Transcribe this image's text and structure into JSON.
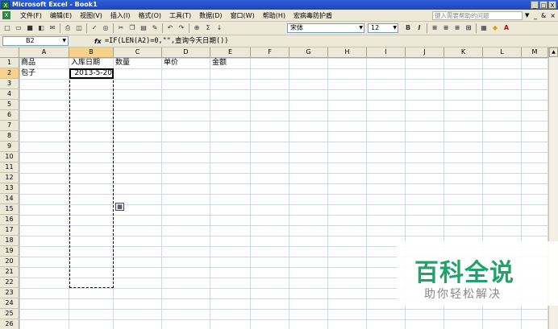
{
  "window": {
    "title": "Microsoft Excel - Book1",
    "controls": [
      "_",
      "□",
      "X"
    ]
  },
  "menu": {
    "items": [
      "文件(F)",
      "编辑(E)",
      "视图(V)",
      "插入(I)",
      "格式(O)",
      "工具(T)",
      "数据(D)",
      "窗口(W)",
      "帮助(H)",
      "宏病毒防护盾"
    ],
    "help_placeholder": "键入需要帮助的问题",
    "doc_controls": [
      "-",
      "_",
      "&",
      "×"
    ]
  },
  "toolbar": {
    "font_name": "宋体",
    "font_size": "12",
    "bold": "B",
    "italic": "I"
  },
  "formula_bar": {
    "name_box": "B2",
    "fx": "fx",
    "formula": "=IF(LEN(A2)=0,\"\",查询今天日期())"
  },
  "grid": {
    "columns": [
      "A",
      "B",
      "C",
      "D",
      "E",
      "F",
      "G",
      "H",
      "I",
      "J",
      "K",
      "L",
      "M"
    ],
    "rows": [
      "1",
      "2",
      "3",
      "4",
      "5",
      "6",
      "7",
      "8",
      "9",
      "10",
      "11",
      "12",
      "13",
      "14",
      "15",
      "16",
      "17",
      "18",
      "19",
      "20",
      "21",
      "22",
      "23",
      "24",
      "25",
      "26"
    ],
    "active_column": "B",
    "active_row": "2",
    "cells": {
      "A1": "商品",
      "B1": "入库日期",
      "C1": "数量",
      "D1": "单价",
      "E1": "金额",
      "A2": "包子",
      "B2": "2013-5-20"
    }
  },
  "watermark": {
    "title": "百科全说",
    "subtitle": "助你轻松解决"
  },
  "colors": {
    "title_bar": "#1d46b8",
    "chrome": "#ece9d8",
    "active_header": "#f8d28a",
    "gridline": "#d0d7e5",
    "watermark": "#1ea36a"
  }
}
